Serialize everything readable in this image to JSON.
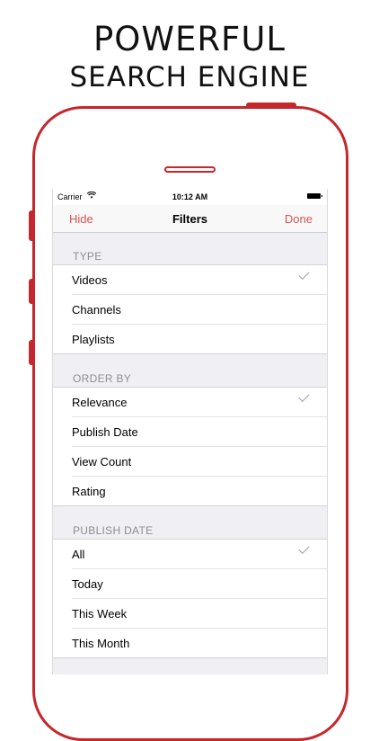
{
  "promo": {
    "line1": "POWERFUL",
    "line2": "SEARCH ENGINE"
  },
  "status_bar": {
    "carrier": "Carrier",
    "time": "10:12 AM"
  },
  "nav": {
    "left": "Hide",
    "title": "Filters",
    "right": "Done"
  },
  "sections": [
    {
      "header": "TYPE",
      "items": [
        "Videos",
        "Channels",
        "Playlists"
      ],
      "selected": 0
    },
    {
      "header": "ORDER BY",
      "items": [
        "Relevance",
        "Publish Date",
        "View Count",
        "Rating"
      ],
      "selected": 0
    },
    {
      "header": "PUBLISH DATE",
      "items": [
        "All",
        "Today",
        "This Week",
        "This Month"
      ],
      "selected": 0
    }
  ],
  "colors": {
    "phone_frame": "#c4272c",
    "nav_accent": "#d9534f",
    "checkmark": "#9e9ea3"
  }
}
